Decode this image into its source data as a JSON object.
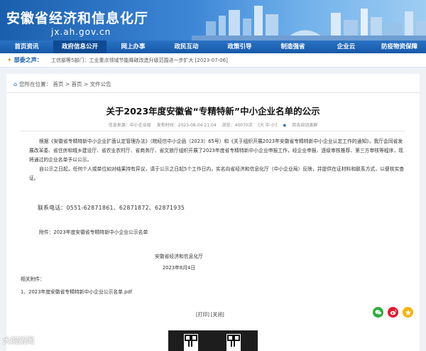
{
  "header": {
    "site_title": "安徽省经济和信息化厅",
    "domain": "jx.ah.gov.cn"
  },
  "nav": [
    {
      "label": "首页资讯"
    },
    {
      "label": "政府信息公开",
      "active": true
    },
    {
      "label": "网上办事"
    },
    {
      "label": "政民互动"
    },
    {
      "label": "政策引导"
    },
    {
      "label": "制造强省"
    },
    {
      "label": "企业云"
    },
    {
      "label": "防疫物资保障"
    }
  ],
  "notice": {
    "label": "部委之声：",
    "text": "工信部等5部门：工业重点领域节能降碳改造升级范围进一步扩大 [2023-07-06]"
  },
  "breadcrumb": {
    "text": "您所在位置： 首页 > 首页 > 文件公告"
  },
  "article": {
    "title": "关于2023年度安徽省“专精特新”中小企业名单的公示",
    "meta_source": "信息来源：中小企业局",
    "meta_time": "发布时间：2023-08-04 21:04",
    "meta_views": "浏览：40070次",
    "meta_font": "[大 中 小]",
    "meta_speak": "双击自动滚屏",
    "para1": "根据《安徽省专精特新中小企业扩面认定管理办法》（皖经信中小企函〔2023〕65号）和《关于组织开展2023年安徽省专精特新中小企业认定工作的通知》，我厅会同省发展改革委、省住房和城乡建设厅、省农业农村厅、省商务厅、省文旅厅组织开展了2023年度省专精特新中小企业申报工作，经企业申报、逐级审核推荐、第三方审核等程序，现将通过的企业名单予以公示。",
    "para2": "自公示之日起，任何个人或单位如对结果持有异议，请于公示之日起5个工作日内，实名向省经济和信息化厅（中小企业局）反映，并提供在证材料和联系方式，以便核实查证。",
    "phone": "联系电话：0551-62871861、62871872、62871935",
    "attachment": "附件：2023年度安徽省专精特新中小企业公示名单",
    "sign_org": "安徽省经济和信息化厅",
    "sign_date": "2023年8月4日",
    "related_label": "相关附件：",
    "pdf_link": "1、2023年度安徽省专精特新中小企业公示名单.pdf",
    "print_label": "[打印]",
    "close_label": "[关闭]"
  },
  "share_icons": [
    "wechat-icon",
    "weibo-icon",
    "qzone-icon"
  ],
  "watermark": "大皖新闻",
  "colors": {
    "brand": "#1a5fae",
    "nav": "#1659a8",
    "accent": "#e58b14"
  }
}
